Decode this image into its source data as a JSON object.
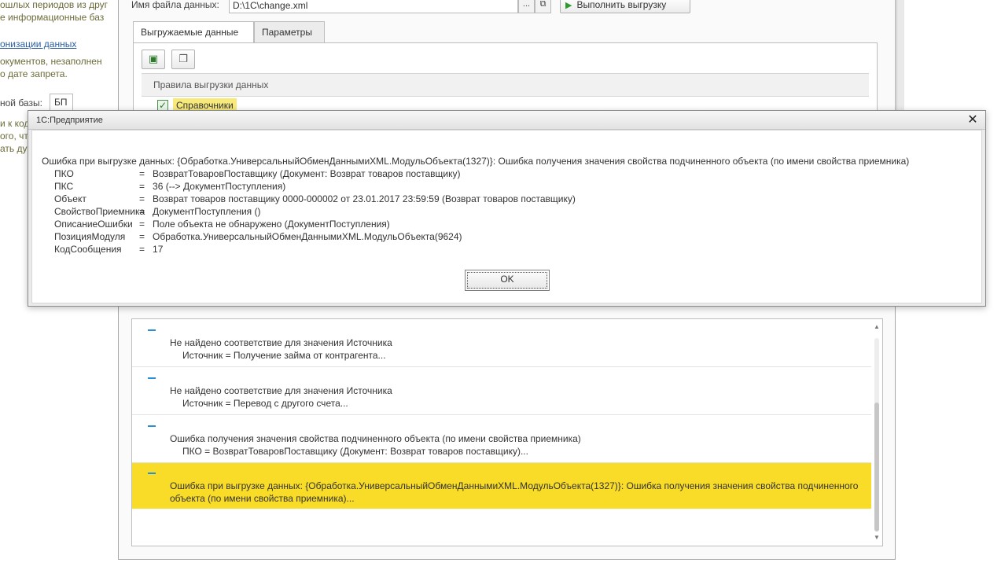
{
  "background_panel": {
    "lines": [
      "ошлых периодов из друг",
      "е информационные баз",
      "онизации данных",
      "окументов, незаполнен",
      "о дате запрета.",
      "ной базы:",
      "и к код",
      "ого, чт",
      "ать ду"
    ],
    "base_value": "БП"
  },
  "main_window": {
    "file_label": "Имя файла данных:",
    "file_value": "D:\\1C\\change.xml",
    "browse_label": "...",
    "open_label": "⧉",
    "run_button": "Выполнить выгрузку",
    "tabs": [
      "Выгружаемые данные",
      "Параметры"
    ],
    "grid_header": "Правила выгрузки данных",
    "grid_row1": "Справочники"
  },
  "dialog": {
    "title": "1С:Предприятие",
    "message": "Ошибка при выгрузке данных: {Обработка.УниверсальныйОбменДаннымиXML.МодульОбъекта(1327)}: Ошибка получения значения свойства подчиненного объекта (по имени свойства приемника)",
    "details": [
      {
        "key": "ПКО",
        "value": "ВозвратТоваровПоставщику  (Документ: Возврат товаров поставщику)"
      },
      {
        "key": "ПКС",
        "value": "36  (--> ДокументПоступления)"
      },
      {
        "key": "Объект",
        "value": "Возврат товаров поставщику 0000-000002 от 23.01.2017 23:59:59  (Возврат товаров поставщику)"
      },
      {
        "key": "СвойствоПриемника",
        "value": "ДокументПоступления  ()"
      },
      {
        "key": "ОписаниеОшибки",
        "value": "Поле объекта не обнаружено (ДокументПоступления)"
      },
      {
        "key": "ПозицияМодуля",
        "value": "Обработка.УниверсальныйОбменДаннымиXML.МодульОбъекта(9624)"
      },
      {
        "key": "КодСообщения",
        "value": "17"
      }
    ],
    "ok_label": "OK"
  },
  "log": {
    "items": [
      {
        "text": "Не найдено соответствие для значения Источника",
        "detail": "Источник                =  Получение займа от контрагента..."
      },
      {
        "text": "Не найдено соответствие для значения Источника",
        "detail": "Источник                =  Перевод с другого счета..."
      },
      {
        "text": "Ошибка получения значения свойства подчиненного объекта (по имени свойства приемника)",
        "detail": "ПКО                  =  ВозвратТоваровПоставщику  (Документ: Возврат товаров поставщику)..."
      },
      {
        "text": "Ошибка при выгрузке данных: {Обработка.УниверсальныйОбменДаннымиXML.МодульОбъекта(1327)}: Ошибка получения значения свойства подчиненного объекта (по имени свойства приемника)...",
        "detail": ""
      }
    ]
  },
  "colors": {
    "highlight": "#f9dc27",
    "dash": "#2c8fd6",
    "link": "#2d5e9e"
  }
}
